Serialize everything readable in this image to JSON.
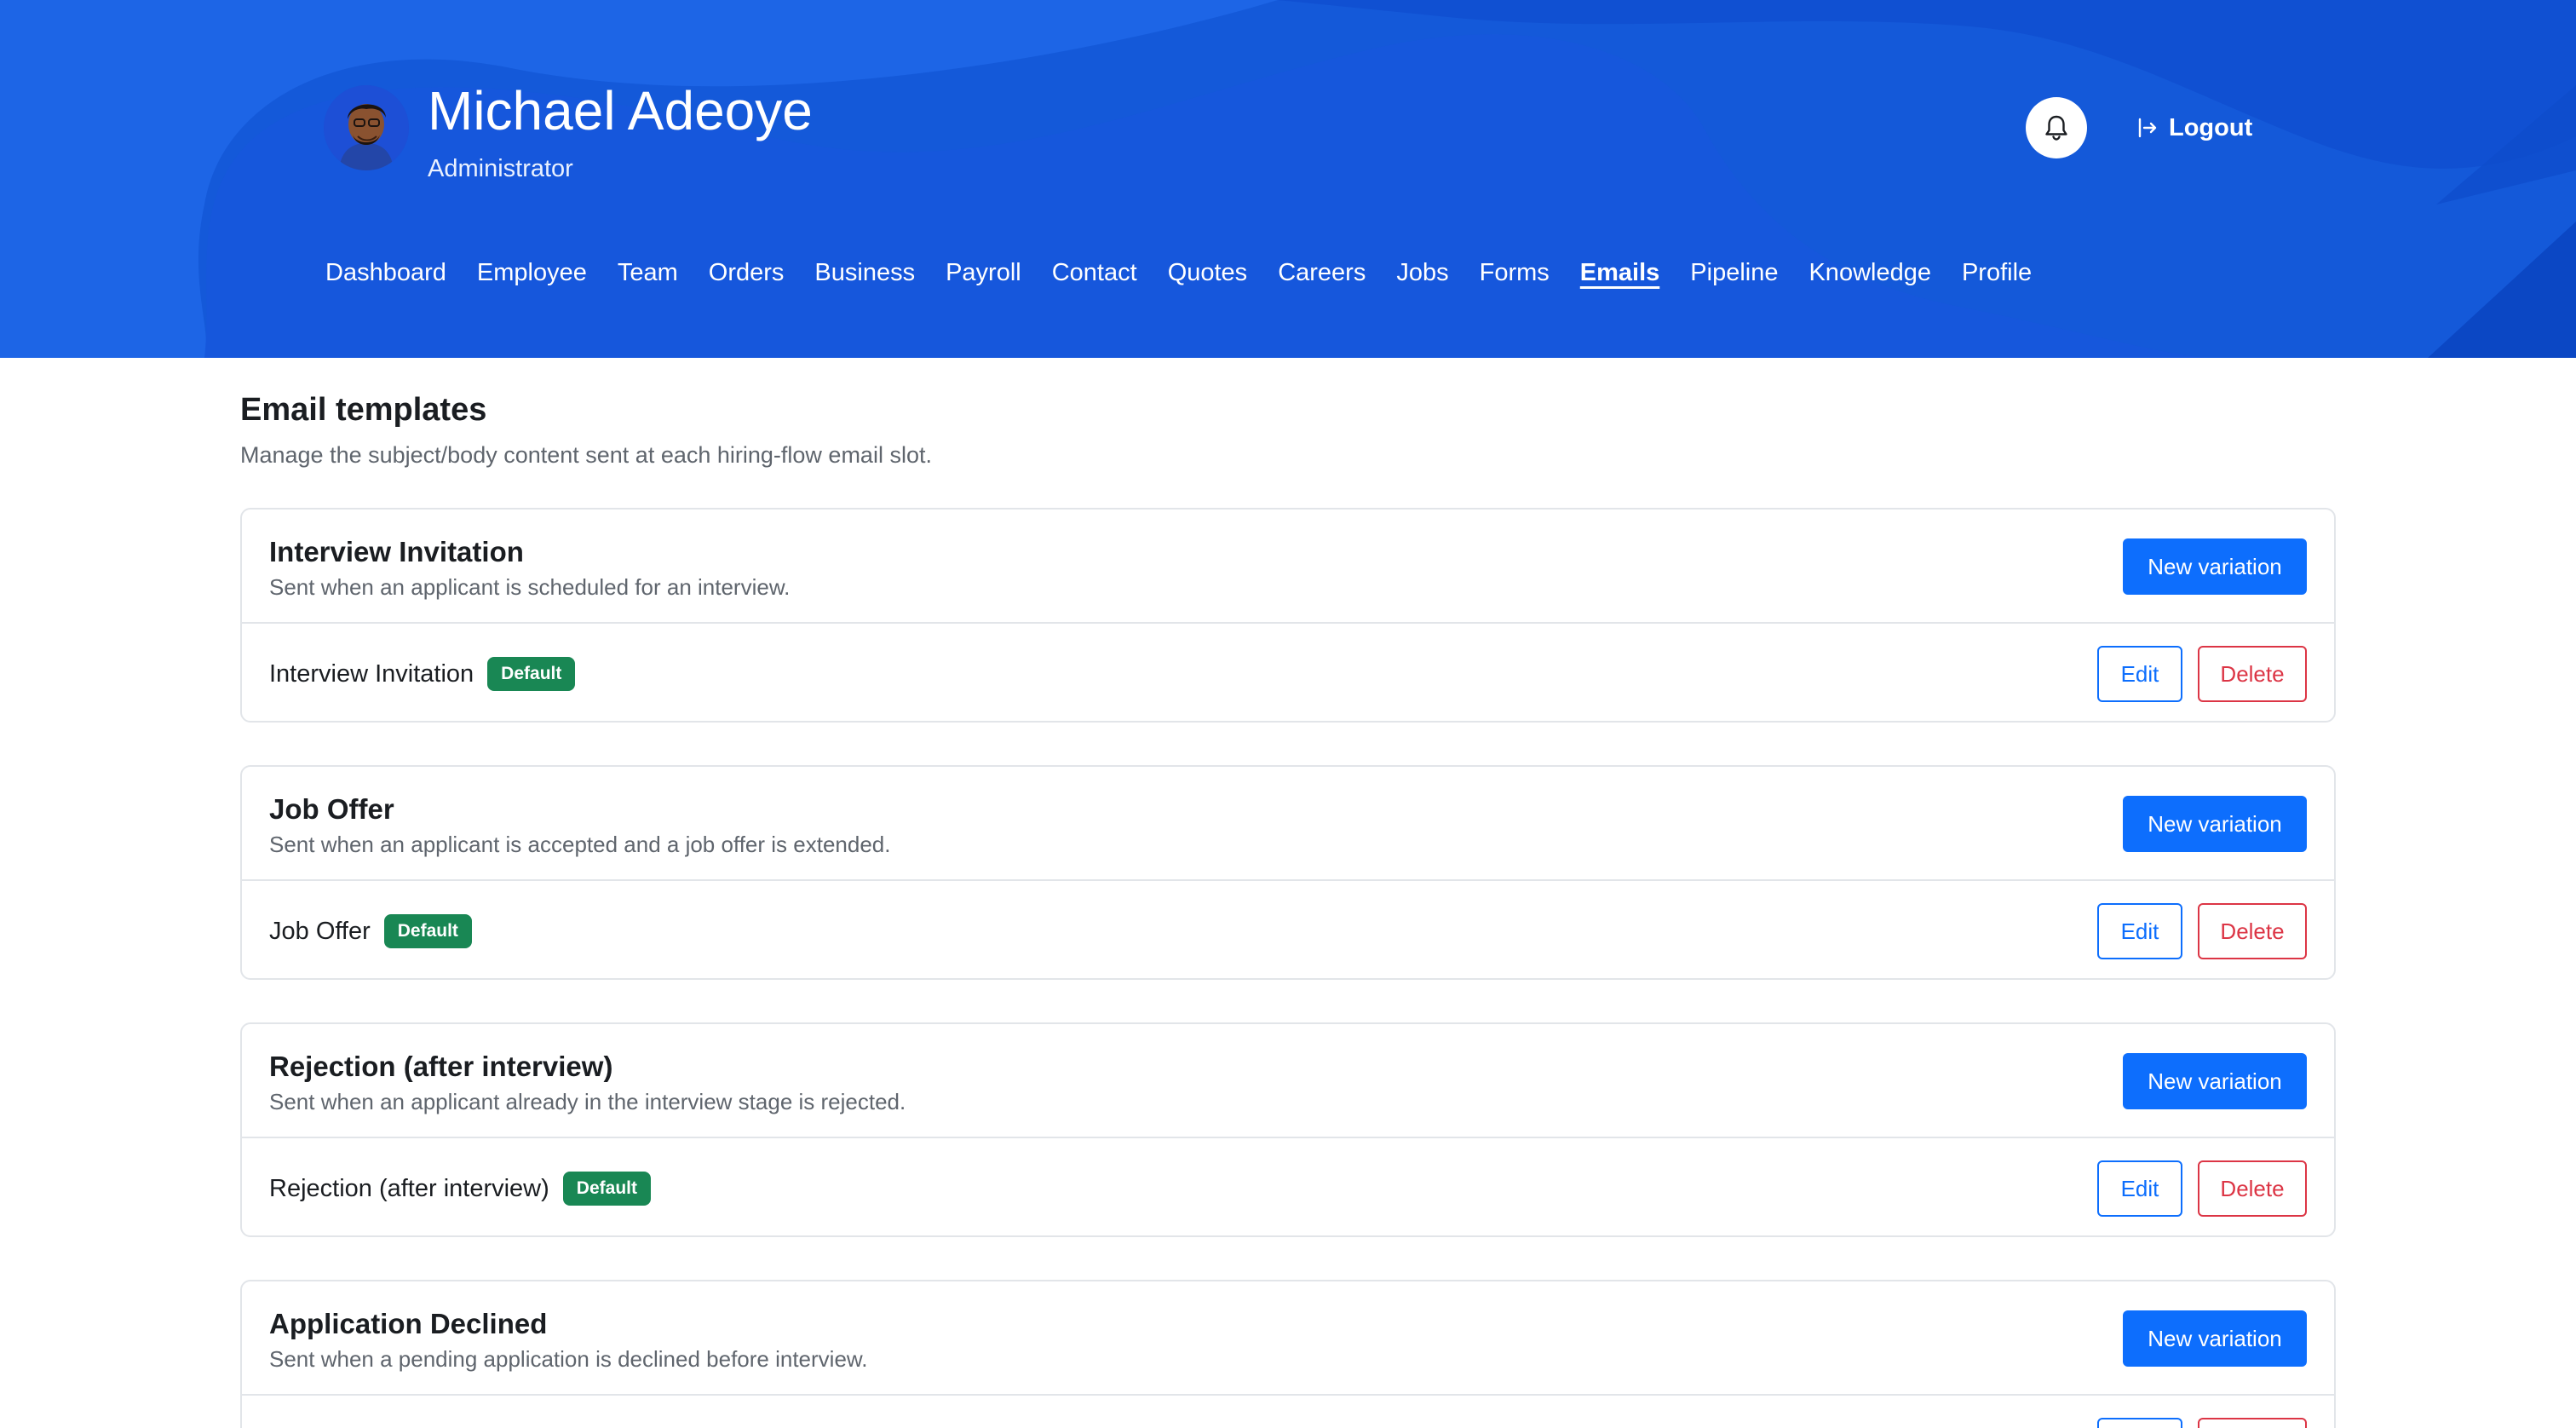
{
  "header": {
    "user_name": "Michael Adeoye",
    "user_role": "Administrator",
    "logout_label": "Logout",
    "colors": {
      "background": "#1459d9",
      "accent_light": "#2d6ff0"
    }
  },
  "nav": {
    "items": [
      {
        "label": "Dashboard",
        "active": false
      },
      {
        "label": "Employee",
        "active": false
      },
      {
        "label": "Team",
        "active": false
      },
      {
        "label": "Orders",
        "active": false
      },
      {
        "label": "Business",
        "active": false
      },
      {
        "label": "Payroll",
        "active": false
      },
      {
        "label": "Contact",
        "active": false
      },
      {
        "label": "Quotes",
        "active": false
      },
      {
        "label": "Careers",
        "active": false
      },
      {
        "label": "Jobs",
        "active": false
      },
      {
        "label": "Forms",
        "active": false
      },
      {
        "label": "Emails",
        "active": true
      },
      {
        "label": "Pipeline",
        "active": false
      },
      {
        "label": "Knowledge",
        "active": false
      },
      {
        "label": "Profile",
        "active": false
      }
    ]
  },
  "page": {
    "title": "Email templates",
    "subtitle": "Manage the subject/body content sent at each hiring-flow email slot."
  },
  "buttons": {
    "new_variation": "New variation",
    "edit": "Edit",
    "delete": "Delete"
  },
  "templates": [
    {
      "title": "Interview Invitation",
      "description": "Sent when an applicant is scheduled for an interview.",
      "variation_name": "Interview Invitation",
      "badge": "Default"
    },
    {
      "title": "Job Offer",
      "description": "Sent when an applicant is accepted and a job offer is extended.",
      "variation_name": "Job Offer",
      "badge": "Default"
    },
    {
      "title": "Rejection (after interview)",
      "description": "Sent when an applicant already in the interview stage is rejected.",
      "variation_name": "Rejection (after interview)",
      "badge": "Default"
    },
    {
      "title": "Application Declined",
      "description": "Sent when a pending application is declined before interview.",
      "variation_name": "",
      "badge": ""
    }
  ],
  "colors": {
    "primary": "#0d6efd",
    "danger": "#dc3545",
    "success": "#198754"
  },
  "icons": {
    "bell": "bell-icon",
    "logout": "logout-icon",
    "avatar": "avatar"
  }
}
